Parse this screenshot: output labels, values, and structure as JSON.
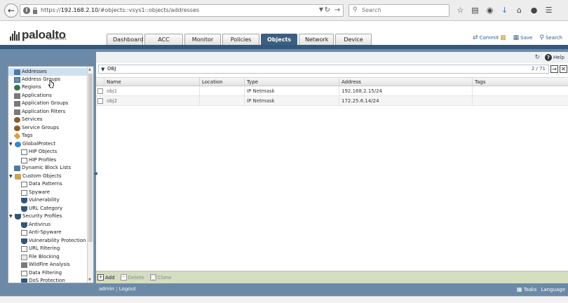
{
  "browser": {
    "url_prefix": "https://",
    "url_host": "192.168.2.10",
    "url_path": "/#objects::vsys1::objects/addresses",
    "search_placeholder": "Search"
  },
  "brand": {
    "logo_text": "paloalto",
    "logo_sub": "NETWORKS"
  },
  "tabs": [
    {
      "label": "Dashboard"
    },
    {
      "label": "ACC"
    },
    {
      "label": "Monitor"
    },
    {
      "label": "Policies"
    },
    {
      "label": "Objects"
    },
    {
      "label": "Network"
    },
    {
      "label": "Device"
    }
  ],
  "header_actions": {
    "commit": "Commit",
    "save": "Save",
    "search": "Search"
  },
  "content_header": {
    "help": "Help"
  },
  "tree": {
    "items": [
      {
        "label": "Addresses"
      },
      {
        "label": "Address Groups"
      },
      {
        "label": "Regions"
      },
      {
        "label": "Applications"
      },
      {
        "label": "Application Groups"
      },
      {
        "label": "Application Filters"
      },
      {
        "label": "Services"
      },
      {
        "label": "Service Groups"
      },
      {
        "label": "Tags"
      },
      {
        "label": "GlobalProtect"
      },
      {
        "label": "HIP Objects"
      },
      {
        "label": "HIP Profiles"
      },
      {
        "label": "Dynamic Block Lists"
      },
      {
        "label": "Custom Objects"
      },
      {
        "label": "Data Patterns"
      },
      {
        "label": "Spyware"
      },
      {
        "label": "Vulnerability"
      },
      {
        "label": "URL Category"
      },
      {
        "label": "Security Profiles"
      },
      {
        "label": "Antivirus"
      },
      {
        "label": "Anti-Spyware"
      },
      {
        "label": "Vulnerability Protection"
      },
      {
        "label": "URL Filtering"
      },
      {
        "label": "File Blocking"
      },
      {
        "label": "WildFire Analysis"
      },
      {
        "label": "Data Filtering"
      },
      {
        "label": "DoS Protection"
      }
    ]
  },
  "filter": {
    "value": "OBJ",
    "count": "2 / 71"
  },
  "table": {
    "columns": [
      "Name",
      "Location",
      "Type",
      "Address",
      "Tags"
    ],
    "rows": [
      {
        "name": "obj1",
        "location": "",
        "type": "IP Netmask",
        "address": "192.168.2.15/24",
        "tags": ""
      },
      {
        "name": "obj2",
        "location": "",
        "type": "IP Netmask",
        "address": "172.25.6.14/24",
        "tags": ""
      }
    ]
  },
  "toolbar": {
    "add": "Add",
    "delete": "Delete",
    "clone": "Clone"
  },
  "status": {
    "user": "admin",
    "logout": "Logout",
    "tasks": "Tasks",
    "language": "Language"
  },
  "colors": {
    "accent": "#3d5f7f",
    "surround": "#6c8aa8",
    "toolbar": "#d4ddc0"
  }
}
